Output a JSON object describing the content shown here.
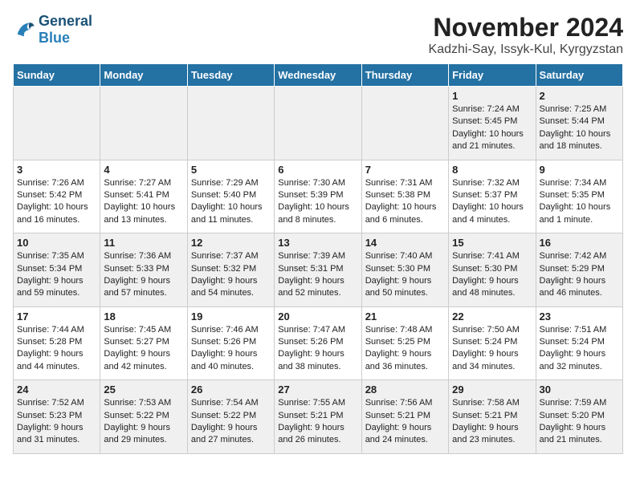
{
  "logo": {
    "general": "General",
    "blue": "Blue"
  },
  "title": "November 2024",
  "subtitle": "Kadzhi-Say, Issyk-Kul, Kyrgyzstan",
  "days_of_week": [
    "Sunday",
    "Monday",
    "Tuesday",
    "Wednesday",
    "Thursday",
    "Friday",
    "Saturday"
  ],
  "weeks": [
    [
      {
        "day": "",
        "info": ""
      },
      {
        "day": "",
        "info": ""
      },
      {
        "day": "",
        "info": ""
      },
      {
        "day": "",
        "info": ""
      },
      {
        "day": "",
        "info": ""
      },
      {
        "day": "1",
        "info": "Sunrise: 7:24 AM\nSunset: 5:45 PM\nDaylight: 10 hours and 21 minutes."
      },
      {
        "day": "2",
        "info": "Sunrise: 7:25 AM\nSunset: 5:44 PM\nDaylight: 10 hours and 18 minutes."
      }
    ],
    [
      {
        "day": "3",
        "info": "Sunrise: 7:26 AM\nSunset: 5:42 PM\nDaylight: 10 hours and 16 minutes."
      },
      {
        "day": "4",
        "info": "Sunrise: 7:27 AM\nSunset: 5:41 PM\nDaylight: 10 hours and 13 minutes."
      },
      {
        "day": "5",
        "info": "Sunrise: 7:29 AM\nSunset: 5:40 PM\nDaylight: 10 hours and 11 minutes."
      },
      {
        "day": "6",
        "info": "Sunrise: 7:30 AM\nSunset: 5:39 PM\nDaylight: 10 hours and 8 minutes."
      },
      {
        "day": "7",
        "info": "Sunrise: 7:31 AM\nSunset: 5:38 PM\nDaylight: 10 hours and 6 minutes."
      },
      {
        "day": "8",
        "info": "Sunrise: 7:32 AM\nSunset: 5:37 PM\nDaylight: 10 hours and 4 minutes."
      },
      {
        "day": "9",
        "info": "Sunrise: 7:34 AM\nSunset: 5:35 PM\nDaylight: 10 hours and 1 minute."
      }
    ],
    [
      {
        "day": "10",
        "info": "Sunrise: 7:35 AM\nSunset: 5:34 PM\nDaylight: 9 hours and 59 minutes."
      },
      {
        "day": "11",
        "info": "Sunrise: 7:36 AM\nSunset: 5:33 PM\nDaylight: 9 hours and 57 minutes."
      },
      {
        "day": "12",
        "info": "Sunrise: 7:37 AM\nSunset: 5:32 PM\nDaylight: 9 hours and 54 minutes."
      },
      {
        "day": "13",
        "info": "Sunrise: 7:39 AM\nSunset: 5:31 PM\nDaylight: 9 hours and 52 minutes."
      },
      {
        "day": "14",
        "info": "Sunrise: 7:40 AM\nSunset: 5:30 PM\nDaylight: 9 hours and 50 minutes."
      },
      {
        "day": "15",
        "info": "Sunrise: 7:41 AM\nSunset: 5:30 PM\nDaylight: 9 hours and 48 minutes."
      },
      {
        "day": "16",
        "info": "Sunrise: 7:42 AM\nSunset: 5:29 PM\nDaylight: 9 hours and 46 minutes."
      }
    ],
    [
      {
        "day": "17",
        "info": "Sunrise: 7:44 AM\nSunset: 5:28 PM\nDaylight: 9 hours and 44 minutes."
      },
      {
        "day": "18",
        "info": "Sunrise: 7:45 AM\nSunset: 5:27 PM\nDaylight: 9 hours and 42 minutes."
      },
      {
        "day": "19",
        "info": "Sunrise: 7:46 AM\nSunset: 5:26 PM\nDaylight: 9 hours and 40 minutes."
      },
      {
        "day": "20",
        "info": "Sunrise: 7:47 AM\nSunset: 5:26 PM\nDaylight: 9 hours and 38 minutes."
      },
      {
        "day": "21",
        "info": "Sunrise: 7:48 AM\nSunset: 5:25 PM\nDaylight: 9 hours and 36 minutes."
      },
      {
        "day": "22",
        "info": "Sunrise: 7:50 AM\nSunset: 5:24 PM\nDaylight: 9 hours and 34 minutes."
      },
      {
        "day": "23",
        "info": "Sunrise: 7:51 AM\nSunset: 5:24 PM\nDaylight: 9 hours and 32 minutes."
      }
    ],
    [
      {
        "day": "24",
        "info": "Sunrise: 7:52 AM\nSunset: 5:23 PM\nDaylight: 9 hours and 31 minutes."
      },
      {
        "day": "25",
        "info": "Sunrise: 7:53 AM\nSunset: 5:22 PM\nDaylight: 9 hours and 29 minutes."
      },
      {
        "day": "26",
        "info": "Sunrise: 7:54 AM\nSunset: 5:22 PM\nDaylight: 9 hours and 27 minutes."
      },
      {
        "day": "27",
        "info": "Sunrise: 7:55 AM\nSunset: 5:21 PM\nDaylight: 9 hours and 26 minutes."
      },
      {
        "day": "28",
        "info": "Sunrise: 7:56 AM\nSunset: 5:21 PM\nDaylight: 9 hours and 24 minutes."
      },
      {
        "day": "29",
        "info": "Sunrise: 7:58 AM\nSunset: 5:21 PM\nDaylight: 9 hours and 23 minutes."
      },
      {
        "day": "30",
        "info": "Sunrise: 7:59 AM\nSunset: 5:20 PM\nDaylight: 9 hours and 21 minutes."
      }
    ]
  ]
}
